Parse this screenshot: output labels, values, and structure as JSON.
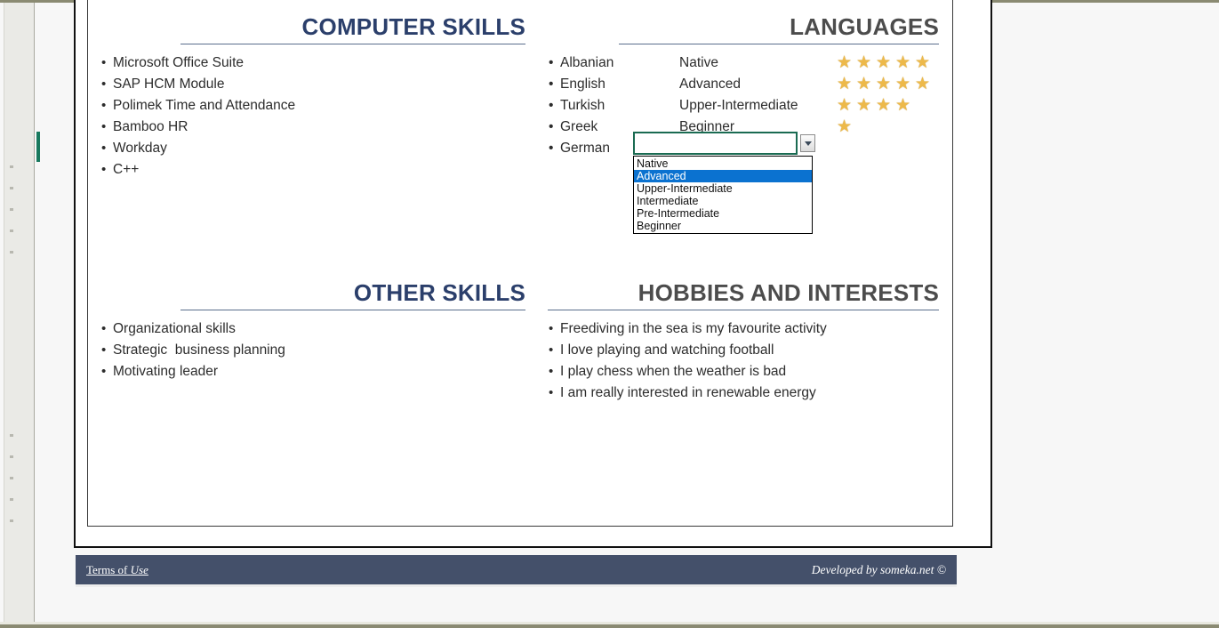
{
  "document": {
    "sections": {
      "computer_skills": {
        "title": "COMPUTER SKILLS",
        "items": [
          "Microsoft Office Suite",
          "SAP HCM Module",
          "Polimek Time and Attendance",
          "Bamboo HR",
          "Workday",
          "C++"
        ]
      },
      "languages": {
        "title": "LANGUAGES",
        "rows": [
          {
            "language": "Albanian",
            "level": "Native",
            "stars": 5
          },
          {
            "language": "English",
            "level": "Advanced",
            "stars": 5
          },
          {
            "language": "Turkish",
            "level": "Upper-Intermediate",
            "stars": 4
          },
          {
            "language": "Greek",
            "level": "Beginner",
            "stars": 1
          },
          {
            "language": "German",
            "level": "",
            "stars": 0
          }
        ]
      },
      "other_skills": {
        "title": "OTHER SKILLS",
        "items": [
          "Organizational skills",
          "Strategic  business planning",
          "Motivating leader"
        ]
      },
      "hobbies": {
        "title": "HOBBIES AND INTERESTS",
        "items": [
          "Freediving in the sea is my favourite activity",
          "I love playing and watching football",
          "I play chess when the weather is bad",
          "I am really interested in renewable energy"
        ]
      }
    }
  },
  "dropdown": {
    "cell_value": "",
    "button_icon": "chevron-down-icon",
    "selected": "Advanced",
    "options": [
      "Native",
      "Advanced",
      "Upper-Intermediate",
      "Intermediate",
      "Pre-Intermediate",
      "Beginner"
    ]
  },
  "footer": {
    "terms_prefix": "Terms of ",
    "terms_emphasis": "Use",
    "credit": "Developed by someka.net ©"
  },
  "bullet_glyph": "•",
  "star_glyph": "★",
  "colors": {
    "navy_heading": "#2b3f6b",
    "grey_heading": "#4c4c4c",
    "rule": "#5a6e8c",
    "star": "#edb94a",
    "footer_bg": "#44506a",
    "active_cell_border": "#1a6b52",
    "dropdown_selected_bg": "#0b72d0"
  }
}
